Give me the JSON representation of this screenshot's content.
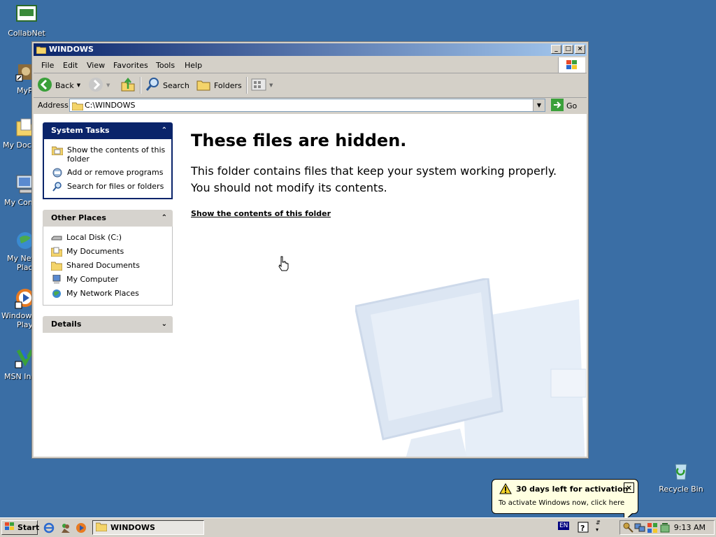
{
  "desktop": {
    "icons": [
      {
        "label": "CollabNet",
        "icon": "collabnet-icon"
      },
      {
        "label": "MyP",
        "icon": "my-pictures-icon"
      },
      {
        "label": "My Docu",
        "icon": "my-documents-icon"
      },
      {
        "label": "My Com",
        "icon": "my-computer-icon"
      },
      {
        "label": "My Net",
        "label2": "Place",
        "icon": "my-network-places-icon"
      },
      {
        "label": "Windows",
        "label2": "Play",
        "icon": "windows-media-player-icon"
      },
      {
        "label": "MSN Ins",
        "icon": "msn-icon"
      },
      {
        "label": "Recycle Bin",
        "icon": "recycle-bin-icon"
      }
    ]
  },
  "window": {
    "title": "WINDOWS",
    "menu": [
      "File",
      "Edit",
      "View",
      "Favorites",
      "Tools",
      "Help"
    ],
    "toolbar": {
      "back": "Back",
      "search": "Search",
      "folders": "Folders"
    },
    "address": {
      "label": "Address",
      "value": "C:\\WINDOWS",
      "go": "Go"
    }
  },
  "left_pane": {
    "system_tasks": {
      "title": "System Tasks",
      "items": [
        {
          "label": "Show the contents of this folder",
          "icon": "folder-view-icon"
        },
        {
          "label": "Add or remove programs",
          "icon": "add-remove-programs-icon"
        },
        {
          "label": "Search for files or folders",
          "icon": "search-icon"
        }
      ]
    },
    "other_places": {
      "title": "Other Places",
      "items": [
        {
          "label": "Local Disk (C:)",
          "icon": "local-disk-icon"
        },
        {
          "label": "My Documents",
          "icon": "my-documents-icon"
        },
        {
          "label": "Shared Documents",
          "icon": "shared-documents-icon"
        },
        {
          "label": "My Computer",
          "icon": "my-computer-icon"
        },
        {
          "label": "My Network Places",
          "icon": "network-places-icon"
        }
      ]
    },
    "details": {
      "title": "Details"
    }
  },
  "main": {
    "heading": "These files are hidden.",
    "line1": "This folder contains files that keep your system working properly.",
    "line2": "You should not modify its contents.",
    "link": "Show the contents of this folder"
  },
  "balloon": {
    "title": "30 days left for activation",
    "text": "To activate Windows now, click here"
  },
  "taskbar": {
    "start": "Start",
    "task": "WINDOWS",
    "lang": "EN",
    "clock": "9:13 AM"
  },
  "colors": {
    "desktop": "#3a6ea5",
    "titlebar_start": "#0a246a",
    "titlebar_end": "#a6caf0",
    "balloon_bg": "#ffffe1"
  }
}
